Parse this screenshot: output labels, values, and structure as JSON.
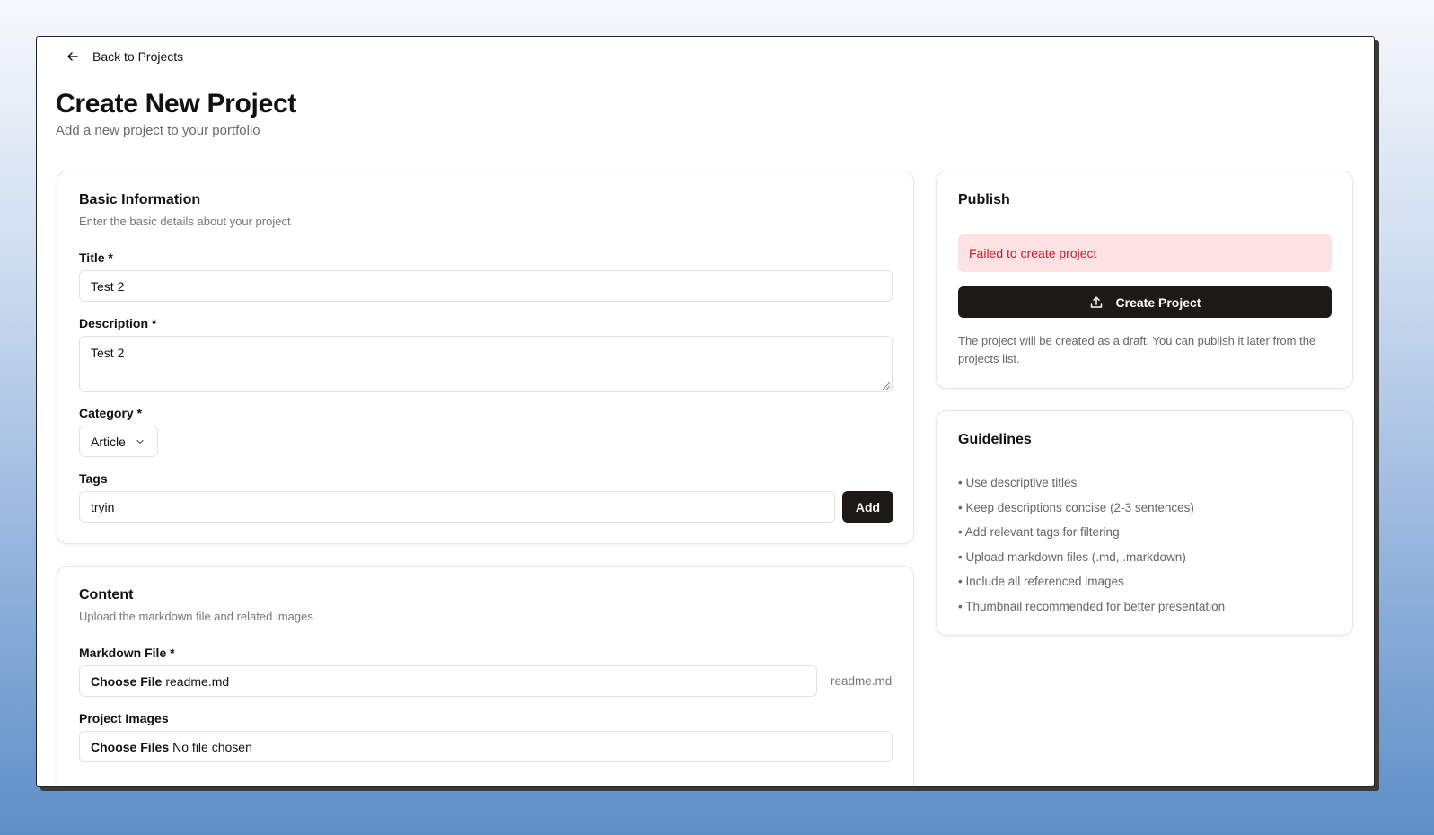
{
  "nav": {
    "back_label": "Back to Projects"
  },
  "page": {
    "title": "Create New Project",
    "subtitle": "Add a new project to your portfolio"
  },
  "basic_info": {
    "title": "Basic Information",
    "description": "Enter the basic details about your project",
    "title_label": "Title *",
    "title_value": "Test 2",
    "description_label": "Description *",
    "description_value": "Test 2",
    "category_label": "Category *",
    "category_value": "Article",
    "tags_label": "Tags",
    "tags_value": "tryin",
    "add_label": "Add"
  },
  "content": {
    "title": "Content",
    "description": "Upload the markdown file and related images",
    "markdown_label": "Markdown File *",
    "markdown_button": "Choose File",
    "markdown_file": "readme.md",
    "markdown_filename_side": "readme.md",
    "images_label": "Project Images",
    "images_button": "Choose Files",
    "images_status": "No file chosen"
  },
  "publish": {
    "title": "Publish",
    "error": "Failed to create project",
    "create_label": "Create Project",
    "note": "The project will be created as a draft. You can publish it later from the projects list."
  },
  "guidelines": {
    "title": "Guidelines",
    "items": [
      "• Use descriptive titles",
      "• Keep descriptions concise (2-3 sentences)",
      "• Add relevant tags for filtering",
      "• Upload markdown files (.md, .markdown)",
      "• Include all referenced images",
      "• Thumbnail recommended for better presentation"
    ]
  },
  "icons": {
    "back": "arrow-left-icon",
    "upload": "upload-icon",
    "chevron": "chevron-down-icon"
  },
  "colors": {
    "primary": "#1c1917",
    "error_bg": "#fde2e4",
    "error_text": "#c0202d"
  }
}
